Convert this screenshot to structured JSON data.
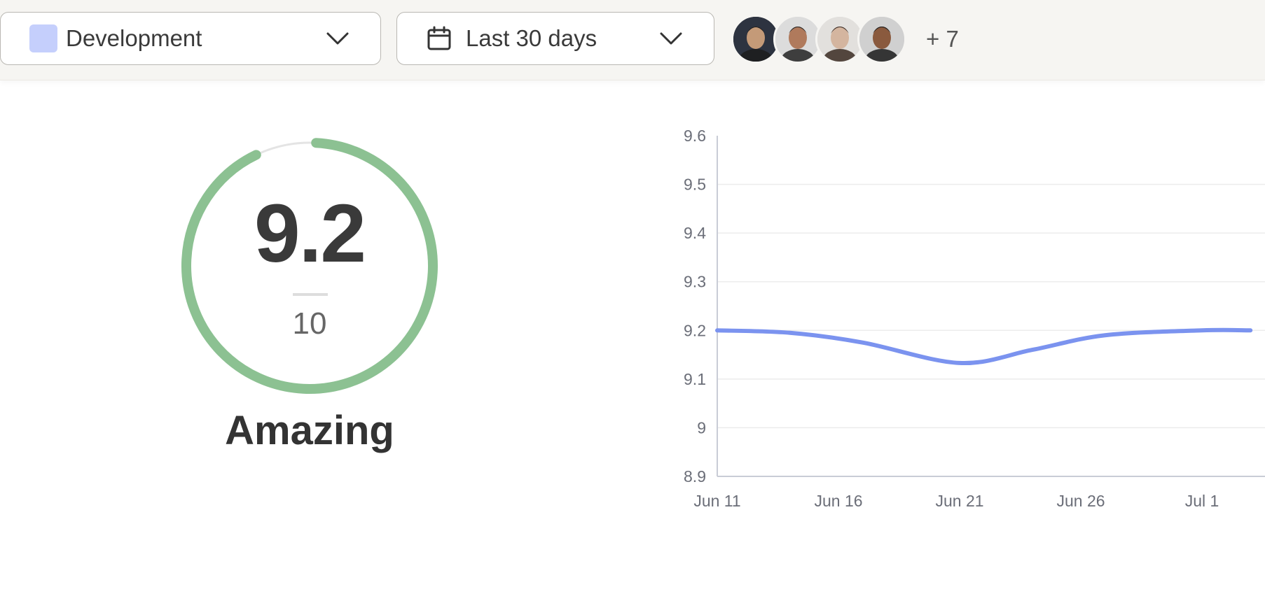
{
  "filters": {
    "team": {
      "label": "Development",
      "color": "#c5cffc"
    },
    "date_range": {
      "label": "Last 30 days"
    },
    "members_more": "+ 7"
  },
  "members": [
    {
      "icon": "avatar-photo",
      "colors": [
        "#2d3340",
        "#c49a78",
        "#1c1c1c"
      ]
    },
    {
      "icon": "avatar-photo",
      "colors": [
        "#dcdcdc",
        "#b07a5c",
        "#222222"
      ]
    },
    {
      "icon": "avatar-photo",
      "colors": [
        "#e2e0dd",
        "#d4b59f",
        "#3a2a22"
      ]
    },
    {
      "icon": "avatar-photo",
      "colors": [
        "#d0d0d0",
        "#8a5a3e",
        "#1a1a1a"
      ]
    }
  ],
  "score": {
    "value": "9.2",
    "max": "10",
    "rating": "Amazing",
    "fraction": 0.92,
    "color": "#8cc192",
    "track_color": "#e4e4e4"
  },
  "chart_data": {
    "type": "line",
    "ylim": [
      8.9,
      9.6
    ],
    "yticks": [
      "9.6",
      "9.5",
      "9.4",
      "9.3",
      "9.2",
      "9.1",
      "9",
      "8.9"
    ],
    "xticks": [
      "Jun 11",
      "Jun 16",
      "Jun 21",
      "Jun 26",
      "Jul 1"
    ],
    "grid": true,
    "color": "#7b93ef",
    "series": [
      {
        "x": [
          "Jun 11",
          "Jun 14",
          "Jun 17",
          "Jun 21",
          "Jun 24",
          "Jun 27",
          "Jul 1",
          "Jul 3"
        ],
        "values": [
          9.2,
          9.195,
          9.175,
          9.133,
          9.16,
          9.19,
          9.2,
          9.2
        ]
      }
    ]
  }
}
